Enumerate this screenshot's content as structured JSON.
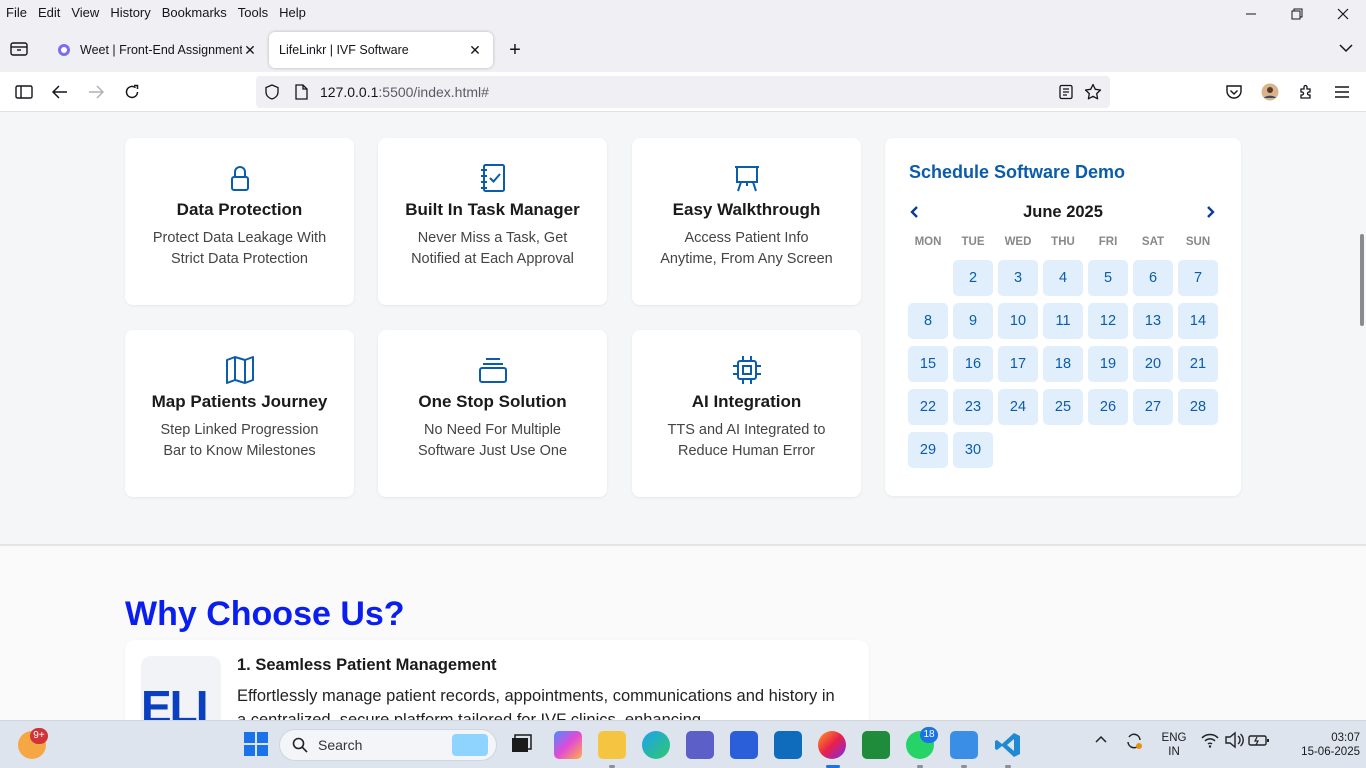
{
  "menubar": {
    "items": [
      {
        "label": "File"
      },
      {
        "label": "Edit"
      },
      {
        "label": "View"
      },
      {
        "label": "History"
      },
      {
        "label": "Bookmarks"
      },
      {
        "label": "Tools"
      },
      {
        "label": "Help"
      }
    ]
  },
  "tabs": [
    {
      "title": "Weet | Front-End Assignment - "
    },
    {
      "title": "LifeLinkr | IVF Software"
    }
  ],
  "address": {
    "host": "127.0.0.1",
    "path": ":5500/index.html#"
  },
  "features": [
    {
      "title": "Data Protection",
      "line1": "Protect Data Leakage With",
      "line2": "Strict Data Protection",
      "icon": "lock-icon"
    },
    {
      "title": "Built In Task Manager",
      "line1": "Never Miss a Task, Get",
      "line2": "Notified at Each Approval",
      "icon": "task-notebook-icon"
    },
    {
      "title": "Easy Walkthrough",
      "line1": "Access Patient Info",
      "line2": "Anytime, From Any Screen",
      "icon": "presentation-board-icon"
    },
    {
      "title": "Map Patients Journey",
      "line1": "Step Linked Progression",
      "line2": "Bar to Know Milestones",
      "icon": "map-icon"
    },
    {
      "title": "One Stop Solution",
      "line1": "No Need For Multiple",
      "line2": "Software Just Use One",
      "icon": "stack-box-icon"
    },
    {
      "title": "AI Integration",
      "line1": "TTS and AI Integrated to",
      "line2": "Reduce Human Error",
      "icon": "cpu-chip-icon"
    }
  ],
  "demo": {
    "title": "Schedule Software Demo",
    "month": "June 2025",
    "weekdays": [
      "MON",
      "TUE",
      "WED",
      "THU",
      "FRI",
      "SAT",
      "SUN"
    ],
    "days": [
      "2",
      "3",
      "4",
      "5",
      "6",
      "7",
      "8",
      "9",
      "10",
      "11",
      "12",
      "13",
      "14",
      "15",
      "16",
      "17",
      "18",
      "19",
      "20",
      "21",
      "22",
      "23",
      "24",
      "25",
      "26",
      "27",
      "28",
      "29",
      "30"
    ],
    "prev": "‹",
    "next": "›"
  },
  "why": {
    "title": "Why Choose Us?",
    "logo_text": "ELI",
    "item_title": "1. Seamless Patient Management",
    "item_text": "Effortlessly manage patient records, appointments, communications and history in a centralized, secure platform tailored for IVF clinics, enhancing"
  },
  "taskbar": {
    "search_placeholder": "Search",
    "widgets_badge": "9+",
    "whatsapp_badge": "18",
    "lang_line1": "ENG",
    "lang_line2": "IN",
    "time": "03:07",
    "date": "15-06-2025"
  },
  "colors": {
    "accent": "#0b5cab",
    "why_title": "#0a1ef0",
    "calendar_day_bg": "#e1eefb"
  }
}
